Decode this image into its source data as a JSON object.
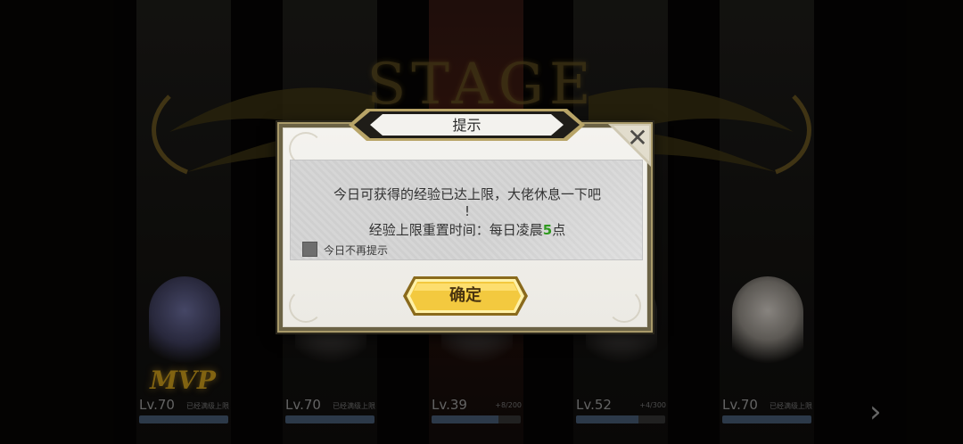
{
  "background": {
    "stage_title": "STAGE",
    "heroes": [
      {
        "level": "Lv.70",
        "hint": "已经满级上限",
        "mvp": "MVP",
        "progress": 1.0
      },
      {
        "level": "Lv.70",
        "hint": "已经满级上限",
        "progress": 1.0
      },
      {
        "level": "Lv.39",
        "hint": "+8/200",
        "progress": 0.75
      },
      {
        "level": "Lv.52",
        "hint": "+4/300",
        "progress": 0.7
      },
      {
        "level": "Lv.70",
        "hint": "已经满级上限",
        "progress": 1.0
      }
    ]
  },
  "dialog": {
    "title": "提示",
    "message_line1": "今日可获得的经验已达上限，大佬休息一下吧",
    "message_line2": "!",
    "message_line3_prefix": "经验上限重置时间：每日凌晨",
    "message_line3_highlight": "5",
    "message_line3_suffix": "点",
    "checkbox_label": "今日不再提示",
    "checkbox_checked": false,
    "confirm_label": "确定",
    "close_label": "✕"
  },
  "colors": {
    "highlight": "#2f9a1f",
    "button_gold": "#f3c93f",
    "frame": "#a99a6a"
  }
}
